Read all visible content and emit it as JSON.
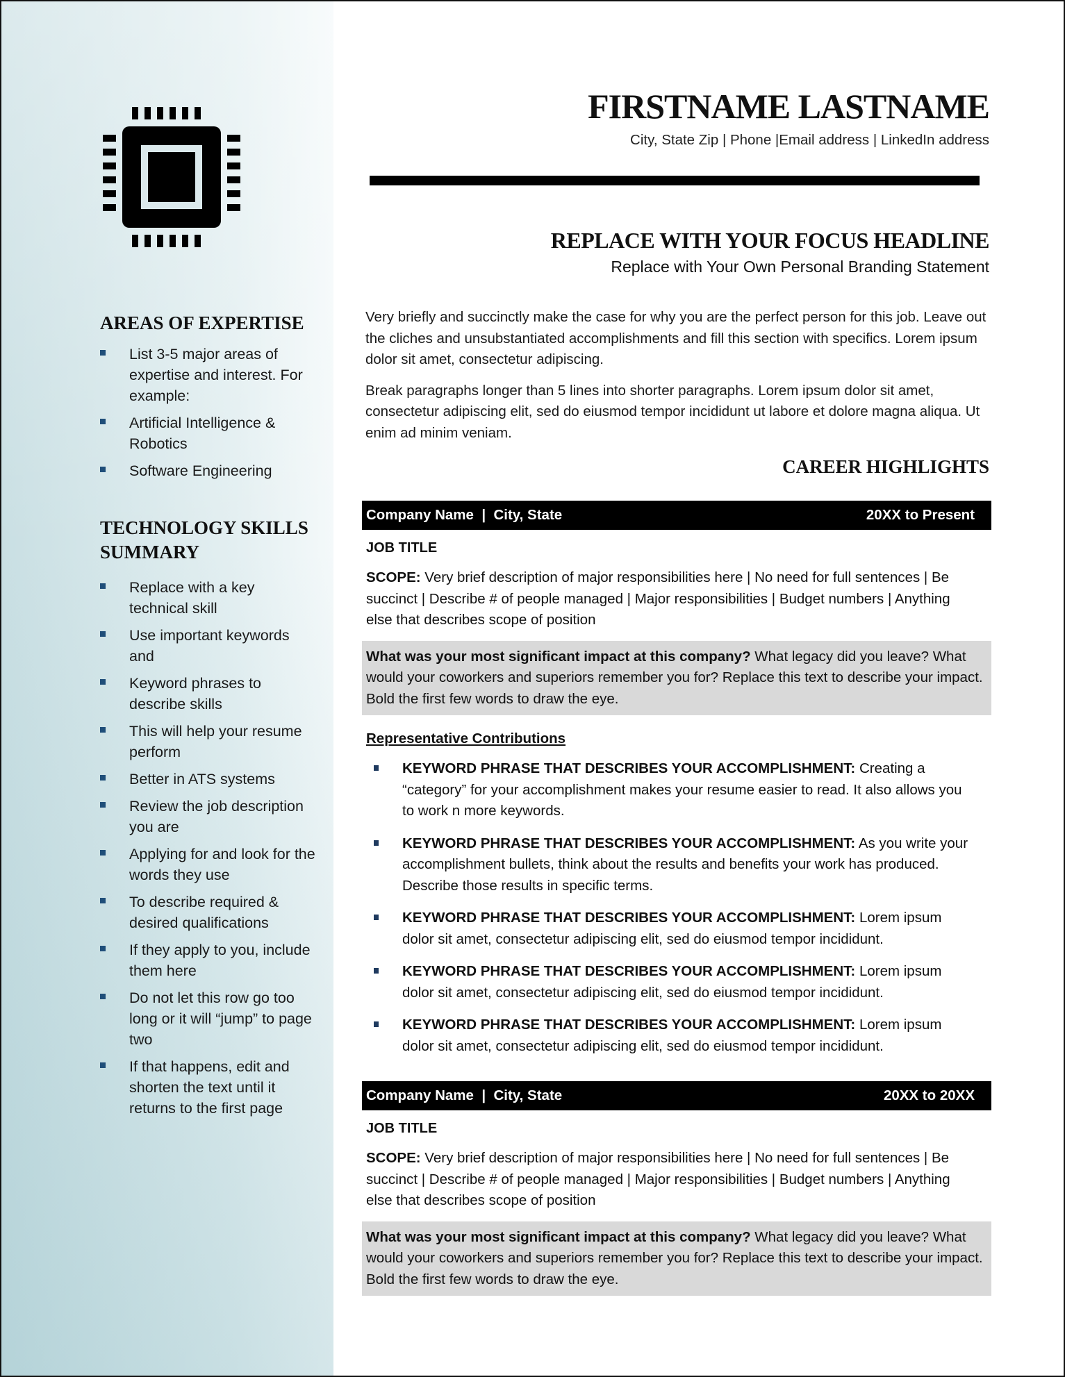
{
  "header": {
    "name": "FIRSTNAME LASTNAME",
    "contact": "City, State Zip | Phone |Email address |  LinkedIn address",
    "headline": "REPLACE WITH YOUR FOCUS HEADLINE",
    "branding": "Replace with Your Own Personal Branding Statement"
  },
  "sidebar": {
    "logo_icon": "microchip-icon",
    "expertise": {
      "title": "AREAS OF EXPERTISE",
      "items": [
        "List 3-5 major areas of expertise and interest. For example:",
        "Artificial Intelligence & Robotics",
        "Software Engineering"
      ]
    },
    "skills": {
      "title": "TECHNOLOGY SKILLS SUMMARY",
      "items": [
        "Replace with a key technical skill",
        "Use important keywords and",
        "Keyword phrases to describe skills",
        "This will help your resume perform",
        "Better in ATS systems",
        "Review the job description you are",
        "Applying for and look for the words they use",
        "To describe required & desired qualifications",
        "If they apply to you, include them here",
        "Do not let this row go too long or it will “jump” to page two",
        "If that happens, edit and shorten the text until it returns to the first page"
      ]
    }
  },
  "summary": [
    "Very briefly and succinctly make the case for why you are the perfect person for this job. Leave out the cliches and unsubstantiated accomplishments and fill this section with specifics. Lorem ipsum dolor sit amet, consectetur adipiscing.",
    "Break paragraphs longer than 5 lines into shorter paragraphs. Lorem ipsum dolor sit amet, consectetur adipiscing elit, sed do eiusmod tempor incididunt ut labore et dolore magna aliqua. Ut enim ad minim veniam."
  ],
  "career_highlights_title": "CAREER HIGHLIGHTS",
  "jobs": [
    {
      "company": "Company Name  |  City, State",
      "dates": "20XX to Present",
      "title": "JOB TITLE",
      "scope_label": "SCOPE:",
      "scope_text": " Very brief description of major responsibilities here | No need for full sentences | Be succinct | Describe # of people managed | Major responsibilities | Budget numbers | Anything else that describes scope of position",
      "impact_bold": "What was your most significant impact at this company?",
      "impact_text": " What legacy did you leave? What would your coworkers and superiors remember you for? Replace this text to describe your impact. Bold the first few words to draw the eye.",
      "contributions_title": "Representative Contributions",
      "contributions": [
        {
          "keyword": "KEYWORD PHRASE THAT DESCRIBES YOUR ACCOMPLISHMENT:",
          "text": " Creating a “category” for your accomplishment makes your resume easier to read. It also allows you to work n more keywords."
        },
        {
          "keyword": "KEYWORD PHRASE THAT DESCRIBES YOUR ACCOMPLISHMENT:",
          "text": " As you write your accomplishment bullets, think about the results and benefits your work has produced. Describe those results in specific terms."
        },
        {
          "keyword": "KEYWORD PHRASE THAT DESCRIBES YOUR ACCOMPLISHMENT:",
          "text": " Lorem ipsum dolor sit amet, consectetur adipiscing elit, sed do eiusmod tempor incididunt."
        },
        {
          "keyword": "KEYWORD PHRASE THAT DESCRIBES YOUR ACCOMPLISHMENT:",
          "text": " Lorem ipsum dolor sit amet, consectetur adipiscing elit, sed do eiusmod tempor incididunt."
        },
        {
          "keyword": "KEYWORD PHRASE THAT DESCRIBES YOUR ACCOMPLISHMENT:",
          "text": " Lorem ipsum dolor sit amet, consectetur adipiscing elit, sed do eiusmod tempor incididunt."
        }
      ]
    },
    {
      "company": "Company Name  |  City, State",
      "dates": "20XX to 20XX",
      "title": "JOB TITLE",
      "scope_label": "SCOPE:",
      "scope_text": " Very brief description of major responsibilities here | No need for full sentences | Be succinct | Describe # of people managed | Major responsibilities | Budget numbers | Anything else that describes scope of position",
      "impact_bold": "What was your most significant impact at this company?",
      "impact_text": " What legacy did you leave? What would your coworkers and superiors remember you for? Replace this text to describe your impact. Bold the first few words to draw the eye."
    }
  ],
  "colors": {
    "bullet": "#1f4e79",
    "sidebar_light": "#f4f9fa",
    "sidebar_dark": "#b8d6dc",
    "company_bar": "#000000",
    "impact_bg": "#d9d9d9"
  }
}
